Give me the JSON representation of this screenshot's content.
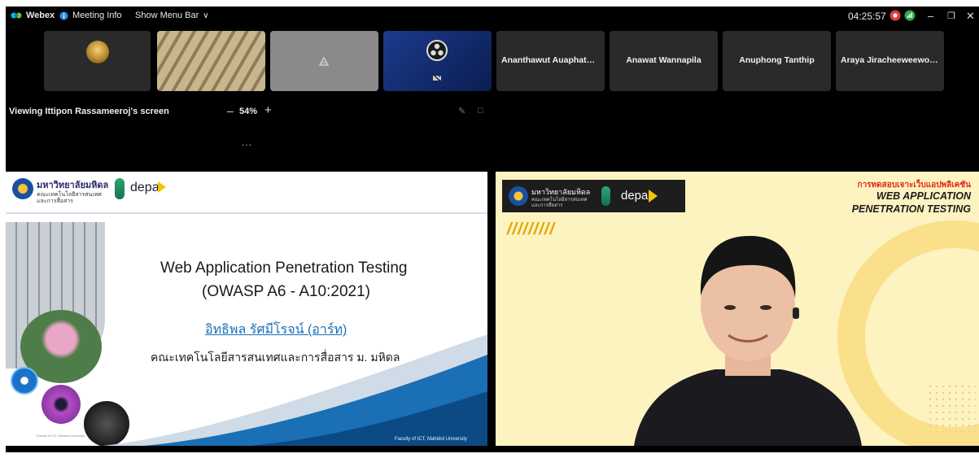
{
  "titlebar": {
    "app_name": "Webex",
    "meeting_info": "Meeting Info",
    "show_menu_bar": "Show Menu Bar",
    "time": "04:25:57"
  },
  "participants": [
    {
      "name": ""
    },
    {
      "name": ""
    },
    {
      "name": ""
    },
    {
      "name": ""
    },
    {
      "name": "Ananthawut Auaphatha..."
    },
    {
      "name": "Anawat Wannapila"
    },
    {
      "name": "Anuphong Tanthip"
    },
    {
      "name": "Araya Jiracheeweewong"
    }
  ],
  "share": {
    "viewing_label": "Viewing Ittipon Rassameeroj's screen",
    "zoom": "54%",
    "more": "..."
  },
  "slide": {
    "university": "มหาวิทยาลัยมหิดล",
    "faculty_line1": "คณะเทคโนโลยีสารสนเทศ",
    "faculty_line2": "และการสื่อสาร",
    "depa": "depa",
    "title_line1": "Web Application Penetration Testing",
    "title_line2": "(OWASP A6 - A10:2021)",
    "presenter": "อิทธิพล รัศมีโรจน์ (อาร์ท)",
    "affiliation": "คณะเทคโนโลยีสารสนเทศและการสื่อสาร ม. มหิดล",
    "footer": "Faculty of ICT, Mahidol University",
    "corner_label": "Faculty of ICT, Mahidol University"
  },
  "video": {
    "university": "มหาวิทยาลัยมหิดล",
    "faculty_line1": "คณะเทคโนโลยีสารสนเทศ",
    "faculty_line2": "และการสื่อสาร",
    "depa": "depa",
    "thai_heading": "การทดสอบเจาะเว็บแอปพลิเคชัน",
    "heading_line1": "WEB APPLICATION",
    "heading_line2": "PENETRATION TESTING",
    "stripes": "/////////"
  },
  "colors": {
    "accent_blue": "#1a6fb5",
    "thai_heading_red": "#e0261b",
    "record_red": "#e33b3b",
    "status_green": "#2ea84a",
    "slide_yellow": "#fdf3c0"
  }
}
